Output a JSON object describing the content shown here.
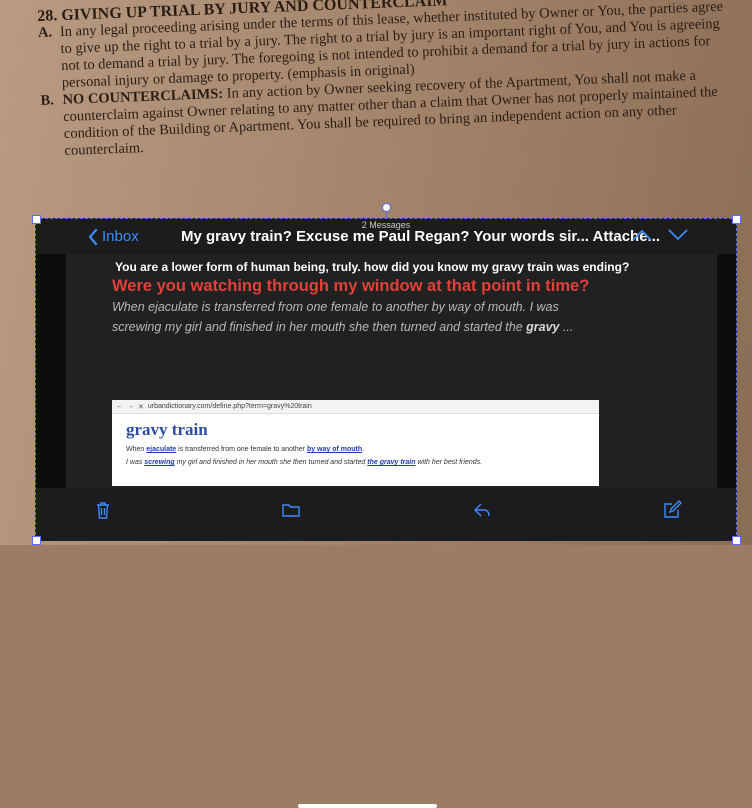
{
  "document": {
    "section_title": "28. GIVING UP TRIAL BY JURY AND COUNTERCLAIM",
    "para_a_letter": "A.",
    "para_a_text": "In any legal proceeding arising under the terms of this lease, whether instituted by Owner or You, the parties agree to give up the right to a trial by a jury. The right to a trial by jury is an important right of You, and You is agreeing not to demand a trial by jury. The foregoing is not intended to prohibit a demand for a trial by jury in actions for personal injury or damage to property. (emphasis in original)",
    "para_b_letter": "B.",
    "para_b_heading": "NO COUNTERCLAIMS:",
    "para_b_text": "In any action by Owner seeking recovery of the Apartment, You shall not make a counterclaim against Owner relating to any matter other than a claim that Owner has not properly maintained the condition of the Building or Apartment. You shall be required to bring an independent action on any other counterclaim."
  },
  "mail": {
    "message_count": "2 Messages",
    "back_label": "Inbox",
    "subject": "My gravy train? Excuse me Paul Regan? Your words sir... Attache...",
    "body_line1": "You are a lower form of human being, truly. how did you know my gravy train was ending?",
    "body_line2": "Were you watching through my window at that point in time?",
    "body_line3_prefix": "When ejaculate is transferred from one female to another by way of mouth. I was screwing my girl and finished in her mouth she then turned and started the ",
    "body_line3_bold": "gravy",
    "body_line3_suffix": " ...",
    "attachment": {
      "url": "urbandictionary.com/define.php?term=gravy%20train",
      "title": "gravy train",
      "def_prefix": "When ",
      "def_link1": "ejaculate",
      "def_mid": " is transferred from one female to another ",
      "def_link2": "by way of mouth",
      "def_end": ".",
      "ex_prefix": "I was ",
      "ex_link1": "screwing",
      "ex_mid": " my girl and finished in her mouth she then turned and started ",
      "ex_link2": "the gravy train",
      "ex_end": " with her best friends."
    }
  },
  "colors": {
    "accent": "#3d8bfd",
    "alert_red": "#e0413a"
  }
}
